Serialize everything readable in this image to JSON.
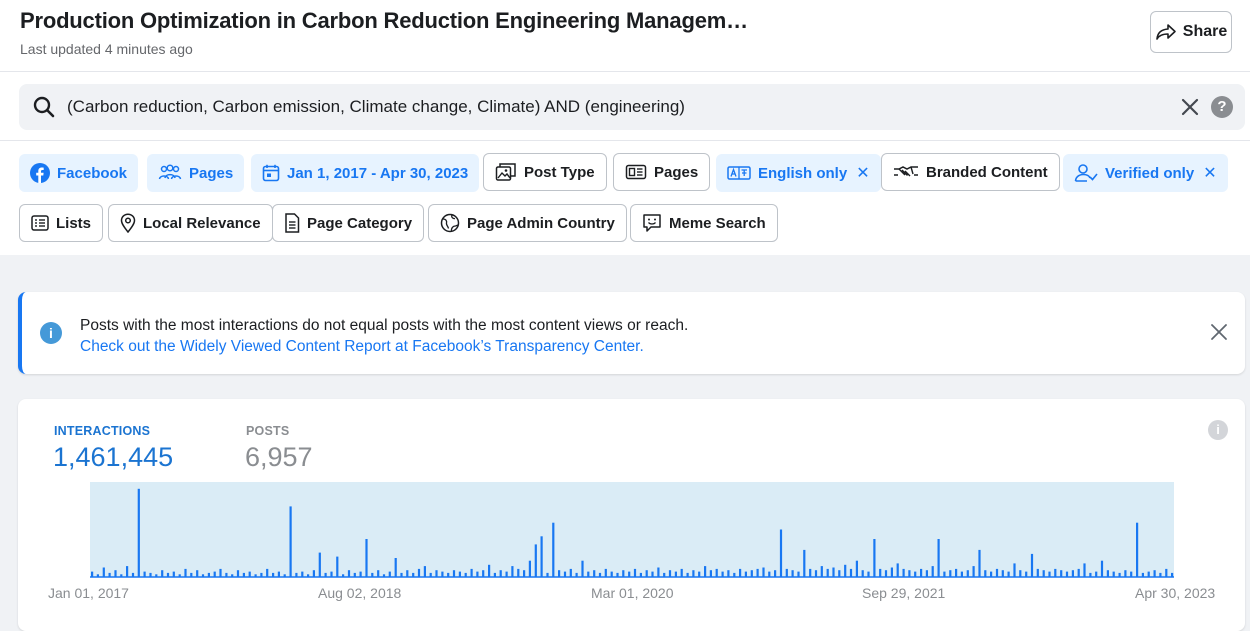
{
  "header": {
    "title": "Production Optimization in Carbon Reduction Engineering Managem…",
    "subtitle": "Last updated 4 minutes ago",
    "share_label": "Share"
  },
  "search": {
    "query": "(Carbon reduction, Carbon emission, Climate change, Climate) AND (engineering)",
    "help_label": "?"
  },
  "filters": {
    "row1": [
      {
        "label": "Facebook",
        "icon": "facebook-icon",
        "active": true
      },
      {
        "label": "Pages",
        "icon": "pages-people-icon",
        "active": true
      },
      {
        "label": "Jan 1, 2017 - Apr 30, 2023",
        "icon": "calendar-icon",
        "active": true
      },
      {
        "label": "Post Type",
        "icon": "post-type-icon",
        "active": false
      },
      {
        "label": "Pages",
        "icon": "page-icon",
        "active": false
      },
      {
        "label": "English only",
        "icon": "language-icon",
        "active": true,
        "removable": true
      },
      {
        "label": "Branded Content",
        "icon": "handshake-icon",
        "active": false
      },
      {
        "label": "Verified only",
        "icon": "verified-user-icon",
        "active": true,
        "removable": true
      }
    ],
    "row2": [
      {
        "label": "Lists",
        "icon": "list-icon"
      },
      {
        "label": "Local Relevance",
        "icon": "location-pin-icon"
      },
      {
        "label": "Page Category",
        "icon": "document-icon"
      },
      {
        "label": "Page Admin Country",
        "icon": "globe-icon"
      },
      {
        "label": "Meme Search",
        "icon": "meme-icon"
      }
    ],
    "remove_glyph": "✕"
  },
  "banner": {
    "line1": "Posts with the most interactions do not equal posts with the most content views or reach.",
    "line2": "Check out the Widely Viewed Content Report at Facebook’s Transparency Center.",
    "info_glyph": "i"
  },
  "stats": {
    "interactions_label": "INTERACTIONS",
    "interactions_value": "1,461,445",
    "posts_label": "POSTS",
    "posts_value": "6,957",
    "info_glyph": "i"
  },
  "chart_data": {
    "type": "bar",
    "x_tick_labels": [
      "Jan 01, 2017",
      "Aug 02, 2018",
      "Mar 01, 2020",
      "Sep 29, 2021",
      "Apr 30, 2023"
    ],
    "x_range": [
      "2017-01-01",
      "2023-04-30"
    ],
    "series": [
      {
        "values": [
          4,
          2,
          7,
          3,
          5,
          2,
          8,
          3,
          65,
          4,
          3,
          2,
          5,
          3,
          4,
          2,
          6,
          3,
          5,
          2,
          3,
          4,
          6,
          3,
          2,
          5,
          3,
          4,
          2,
          3,
          6,
          3,
          4,
          2,
          52,
          3,
          4,
          2,
          5,
          18,
          3,
          4,
          15,
          2,
          5,
          3,
          4,
          28,
          3,
          5,
          2,
          4,
          14,
          3,
          5,
          3,
          6,
          8,
          3,
          5,
          4,
          3,
          5,
          4,
          3,
          6,
          4,
          5,
          9,
          3,
          5,
          4,
          8,
          6,
          5,
          12,
          24,
          30,
          3,
          40,
          5,
          4,
          6,
          3,
          12,
          4,
          5,
          3,
          6,
          4,
          3,
          5,
          4,
          6,
          3,
          5,
          4,
          7,
          3,
          5,
          4,
          6,
          3,
          5,
          4,
          8,
          5,
          6,
          4,
          5,
          3,
          6,
          4,
          5,
          6,
          7,
          4,
          5,
          35,
          6,
          5,
          4,
          20,
          6,
          5,
          8,
          6,
          7,
          5,
          9,
          6,
          12,
          5,
          4,
          28,
          6,
          5,
          7,
          10,
          6,
          5,
          4,
          6,
          5,
          8,
          28,
          4,
          5,
          6,
          4,
          5,
          8,
          20,
          5,
          4,
          6,
          5,
          4,
          10,
          5,
          4,
          17,
          6,
          5,
          4,
          6,
          5,
          4,
          5,
          6,
          10,
          3,
          4,
          12,
          5,
          4,
          3,
          5,
          4,
          40,
          3,
          4,
          5,
          3,
          6,
          3
        ]
      }
    ],
    "ylim": [
      0,
      70
    ]
  },
  "colors": {
    "accent": "#1877f2",
    "bar": "#1877f2",
    "plot_bg": "#daecf6",
    "interactions": "#1b74d1",
    "posts": "#8a8d91"
  }
}
